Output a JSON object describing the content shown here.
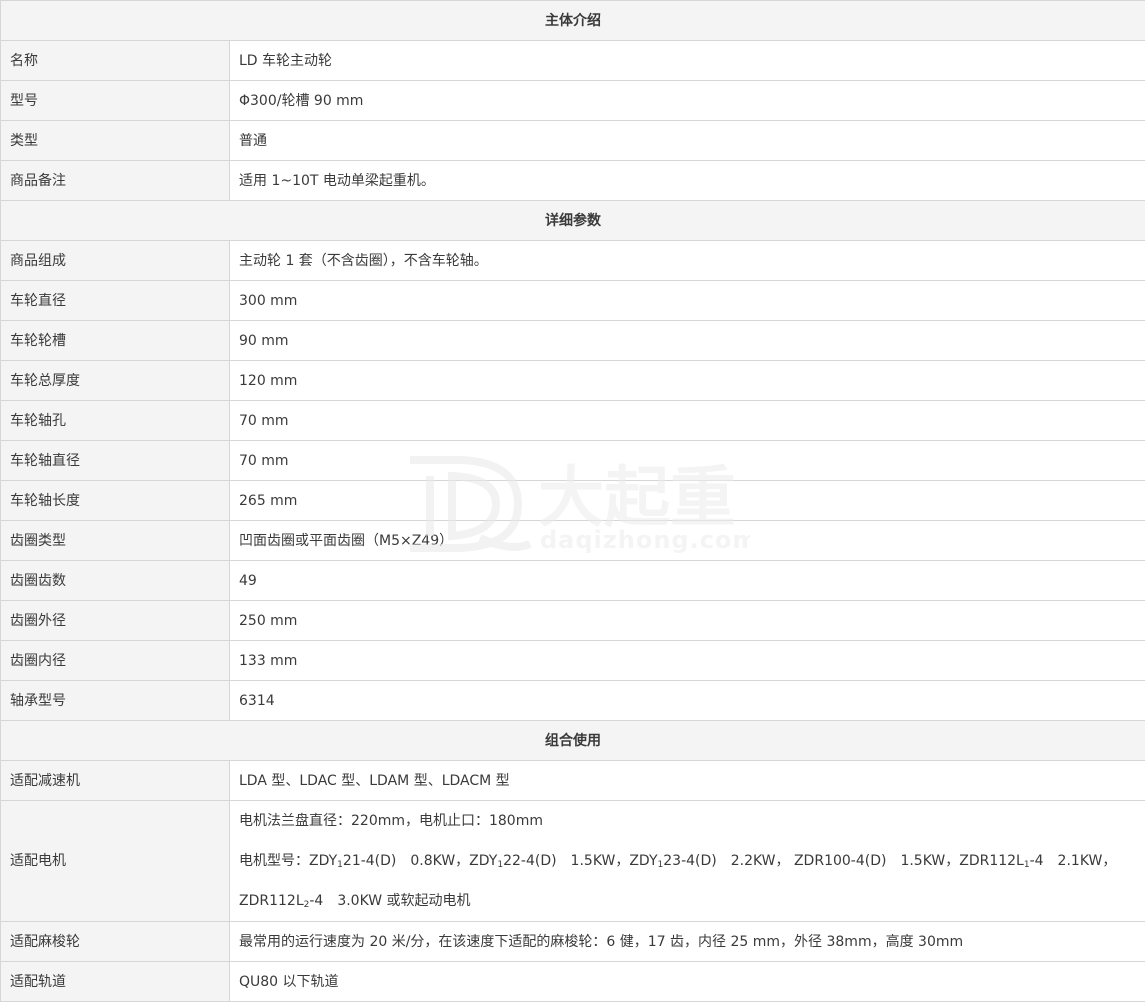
{
  "sections": {
    "intro": "主体介绍",
    "detail": "详细参数",
    "combo": "组合使用"
  },
  "intro_rows": [
    {
      "label": "名称",
      "value": "LD 车轮主动轮"
    },
    {
      "label": "型号",
      "value": "Φ300/轮槽 90 mm"
    },
    {
      "label": "类型",
      "value": "普通"
    },
    {
      "label": "商品备注",
      "value": "适用 1~10T 电动单梁起重机。"
    }
  ],
  "detail_rows": [
    {
      "label": "商品组成",
      "value": "主动轮 1 套（不含齿圈），不含车轮轴。"
    },
    {
      "label": "车轮直径",
      "value": "300 mm"
    },
    {
      "label": "车轮轮槽",
      "value": "90 mm"
    },
    {
      "label": "车轮总厚度",
      "value": "120 mm"
    },
    {
      "label": "车轮轴孔",
      "value": "70 mm"
    },
    {
      "label": "车轮轴直径",
      "value": "70 mm"
    },
    {
      "label": "车轮轴长度",
      "value": "265 mm"
    },
    {
      "label": "齿圈类型",
      "value": "凹面齿圈或平面齿圈（M5×Z49）"
    },
    {
      "label": "齿圈齿数",
      "value": "49"
    },
    {
      "label": "齿圈外径",
      "value": "250 mm"
    },
    {
      "label": "齿圈内径",
      "value": "133 mm"
    },
    {
      "label": "轴承型号",
      "value": "6314"
    }
  ],
  "combo": {
    "reducer": {
      "label": "适配减速机",
      "value": "LDA 型、LDAC 型、LDAM 型、LDACM 型"
    },
    "motor": {
      "label": "适配电机",
      "line1": "电机法兰盘直径：220mm，电机止口：180mm",
      "line2_parts": [
        "电机型号：ZDY",
        "1",
        "21-4(D)　0.8KW，ZDY",
        "1",
        "22-4(D)　1.5KW，ZDY",
        "1",
        "23-4(D)　2.2KW， ZDR100-4(D)　1.5KW，ZDR112L",
        "1",
        "-4　2.1KW，"
      ],
      "line3_parts": [
        "ZDR112L",
        "2",
        "-4　3.0KW 或软起动电机"
      ]
    },
    "wheel": {
      "label": "适配麻梭轮",
      "value": "最常用的运行速度为 20 米/分，在该速度下适配的麻梭轮：6 健，17 齿，内径 25 mm，外径 38mm，高度 30mm"
    },
    "track": {
      "label": "适配轨道",
      "value": "QU80 以下轨道"
    }
  },
  "watermark": {
    "cn": "大起重",
    "en": "daqizhong.com"
  }
}
